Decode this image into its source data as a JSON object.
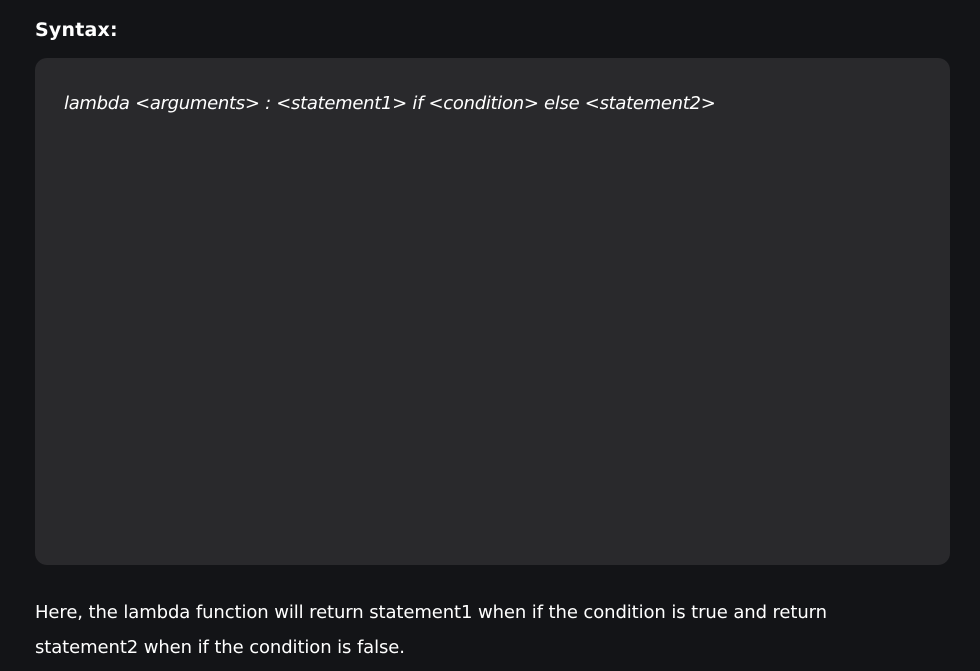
{
  "syntax_section": {
    "heading": "Syntax:",
    "code": "lambda <arguments> : <statement1> if <condition> else <statement2>"
  },
  "description": {
    "text": "Here, the lambda function will return statement1 when if the condition is true and return statement2 when if the condition is false."
  }
}
